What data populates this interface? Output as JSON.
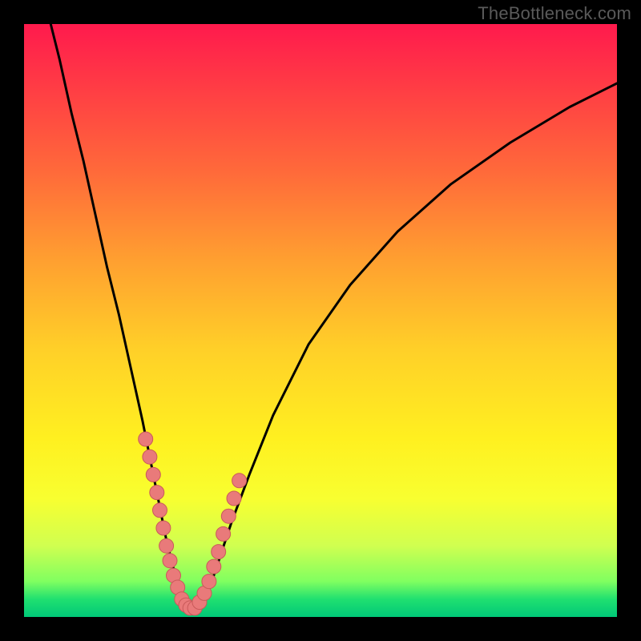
{
  "watermark": "TheBottleneck.com",
  "colors": {
    "curve_stroke": "#000000",
    "dot_fill": "#e97a7a",
    "dot_stroke": "#c95a5a",
    "frame": "#000000"
  },
  "chart_data": {
    "type": "line",
    "title": "",
    "xlabel": "",
    "ylabel": "",
    "xlim": [
      0,
      100
    ],
    "ylim": [
      0,
      100
    ],
    "grid": false,
    "series": [
      {
        "name": "bottleneck-curve",
        "comment": "V-shaped curve; y ≈ 0 at x ≈ 27, rises steeply on both sides (left branch steeper).",
        "x": [
          4,
          6,
          8,
          10,
          12,
          14,
          16,
          18,
          20,
          22,
          23,
          24,
          25,
          26,
          27,
          28,
          29,
          30,
          31,
          32,
          33,
          35,
          38,
          42,
          48,
          55,
          63,
          72,
          82,
          92,
          100
        ],
        "y": [
          102,
          94,
          85,
          77,
          68,
          59,
          51,
          42,
          33,
          23,
          18,
          13,
          9,
          5,
          2,
          1,
          1,
          2,
          4,
          7,
          10,
          16,
          24,
          34,
          46,
          56,
          65,
          73,
          80,
          86,
          90
        ]
      }
    ],
    "points": {
      "name": "highlight-dots",
      "comment": "Salmon-colored scatter dots clustered along the lower portion of both branches near the valley.",
      "x": [
        20.5,
        21.2,
        21.8,
        22.4,
        22.9,
        23.5,
        24.0,
        24.6,
        25.2,
        25.9,
        26.6,
        27.3,
        28.0,
        28.8,
        29.6,
        30.4,
        31.2,
        32.0,
        32.8,
        33.6,
        34.5,
        35.4,
        36.3
      ],
      "y": [
        30,
        27,
        24,
        21,
        18,
        15,
        12,
        9.5,
        7,
        5,
        3,
        2,
        1.5,
        1.5,
        2.5,
        4,
        6,
        8.5,
        11,
        14,
        17,
        20,
        23
      ]
    }
  }
}
